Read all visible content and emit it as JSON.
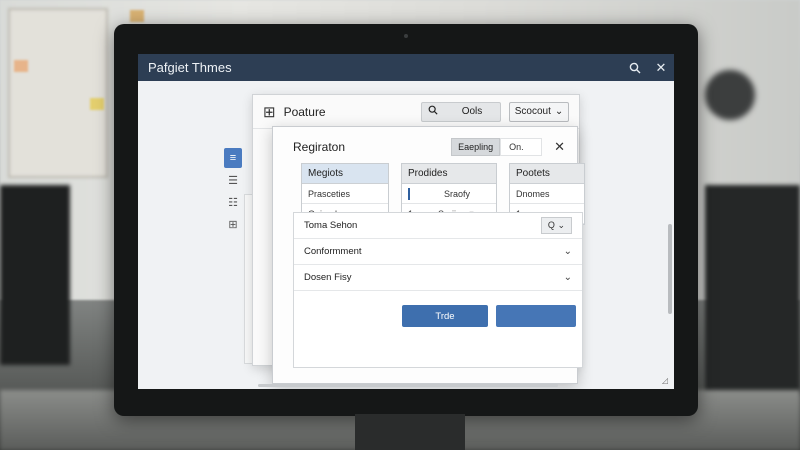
{
  "window": {
    "title": "Pafgiet Thmes",
    "search_icon": "search-icon",
    "close_icon": "close-icon"
  },
  "left_tools": [
    {
      "icon": "doc-icon",
      "glyph": "≡",
      "active": true
    },
    {
      "icon": "list-icon",
      "glyph": "☰",
      "active": false
    },
    {
      "icon": "list-icon",
      "glyph": "☷",
      "active": false
    },
    {
      "icon": "grid-icon",
      "glyph": "⊞",
      "active": false
    }
  ],
  "back_window": {
    "title": "Poature",
    "search_label": "Ools",
    "select_value": "Scocout"
  },
  "front_window": {
    "title": "Regiraton",
    "segment_a": "Eaepling",
    "segment_b": "On.",
    "columns": [
      {
        "header": "Megiots",
        "cells": [
          "Prasceties",
          "Ooioad"
        ]
      },
      {
        "header": "Prodides",
        "cells": [
          "Sraofy",
          "Sraiios"
        ]
      },
      {
        "header": "Pootets",
        "cells": [
          "Dnomes",
          "1"
        ]
      }
    ],
    "col2_cell_values": [
      "",
      "1"
    ],
    "section_title": "Toma Sehon",
    "section_button": "Q",
    "accordion": [
      {
        "label": "Conformment"
      },
      {
        "label": "Dosen Fisy"
      }
    ],
    "primary_button": "Trde"
  }
}
